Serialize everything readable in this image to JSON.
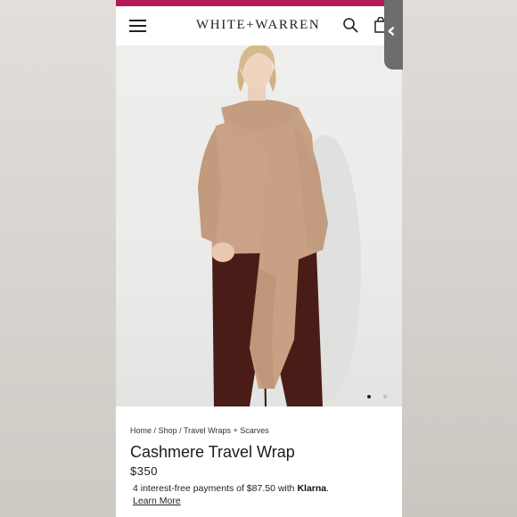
{
  "header": {
    "logo": "WHITE+WARREN",
    "menu_icon": "hamburger-menu-icon",
    "search_icon": "search-icon",
    "cart_icon": "shopping-bag-icon"
  },
  "colors": {
    "top_strip": "#b51b5a",
    "sweater": "#c9a287",
    "pants": "#4a1c17",
    "background": "#ebebe9"
  },
  "side_tab": {
    "glyph": "‹"
  },
  "carousel": {
    "active_index": 0,
    "count": 2
  },
  "breadcrumb": {
    "items": [
      "Home",
      "Shop",
      "Travel Wraps + Scarves"
    ],
    "separator": "/"
  },
  "product": {
    "title": "Cashmere Travel Wrap",
    "price": "$350",
    "klarna_prefix": "4 interest-free payments of $87.50 with ",
    "klarna_brand": "Klarna",
    "klarna_suffix": ".",
    "learn_more": "Learn More"
  }
}
